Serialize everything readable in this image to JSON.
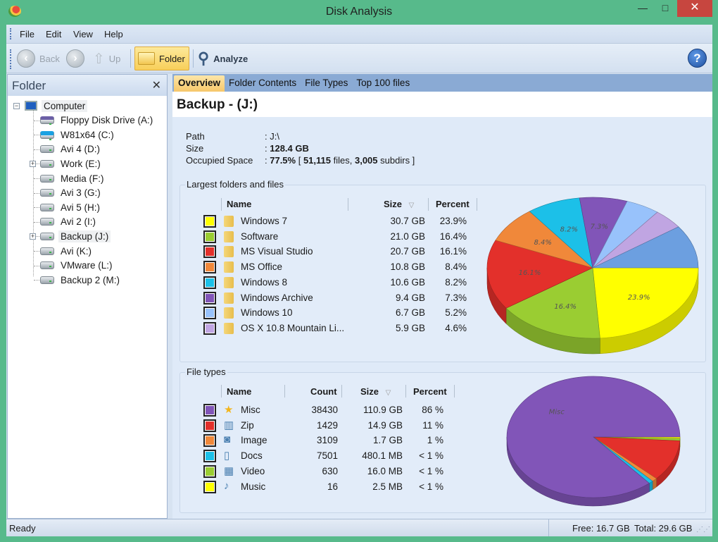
{
  "window": {
    "title": "Disk Analysis",
    "minimize": "—",
    "maximize": "□",
    "close": "✕"
  },
  "menu": [
    "File",
    "Edit",
    "View",
    "Help"
  ],
  "toolbar": {
    "back": "Back",
    "forward_icon": "arrow-right-icon",
    "up": "Up",
    "folder": "Folder",
    "analyze": "Analyze",
    "help": "?"
  },
  "sidebar": {
    "title": "Folder",
    "close": "✕",
    "root": "Computer",
    "items": [
      {
        "label": "Floppy Disk Drive (A:)",
        "icon": "floppy-icon",
        "expandable": false
      },
      {
        "label": "W81x64 (C:)",
        "icon": "windows-drive-icon",
        "expandable": false
      },
      {
        "label": "Avi 4 (D:)",
        "icon": "drive-icon",
        "expandable": false
      },
      {
        "label": "Work (E:)",
        "icon": "drive-icon",
        "expandable": true
      },
      {
        "label": "Media (F:)",
        "icon": "drive-icon",
        "expandable": false
      },
      {
        "label": "Avi 3 (G:)",
        "icon": "drive-icon",
        "expandable": false
      },
      {
        "label": "Avi 5 (H:)",
        "icon": "drive-icon",
        "expandable": false
      },
      {
        "label": "Avi 2 (I:)",
        "icon": "drive-icon",
        "expandable": false
      },
      {
        "label": "Backup (J:)",
        "icon": "drive-icon",
        "expandable": true,
        "selected": true
      },
      {
        "label": "Avi (K:)",
        "icon": "drive-icon",
        "expandable": false
      },
      {
        "label": "VMware (L:)",
        "icon": "drive-icon",
        "expandable": false
      },
      {
        "label": "Backup 2 (M:)",
        "icon": "drive-icon",
        "expandable": false
      }
    ]
  },
  "tabs": [
    {
      "label": "Overview",
      "active": true
    },
    {
      "label": "Folder Contents"
    },
    {
      "label": "File Types"
    },
    {
      "label": "Top 100 files"
    }
  ],
  "overview": {
    "heading": "Backup - (J:)",
    "path_label": "Path",
    "path_value": ": J:\\",
    "size_label": "Size",
    "size_value": "128.4 GB",
    "occupied_label": "Occupied Space",
    "occupied_pct": "77.5%",
    "files": "51,115",
    "files_word": "files,",
    "subdirs": "3,005",
    "subdirs_word": "subdirs ]"
  },
  "largest": {
    "title": "Largest folders and files",
    "columns": {
      "name": "Name",
      "size": "Size",
      "percent": "Percent"
    },
    "rows": [
      {
        "name": "Windows 7",
        "size": "30.7 GB",
        "percent": "23.9%",
        "color": "#ffff00"
      },
      {
        "name": "Software",
        "size": "21.0 GB",
        "percent": "16.4%",
        "color": "#9acd32"
      },
      {
        "name": "MS Visual Studio",
        "size": "20.7 GB",
        "percent": "16.1%",
        "color": "#e3302b"
      },
      {
        "name": "MS Office",
        "size": "10.8 GB",
        "percent": "8.4%",
        "color": "#f0883a"
      },
      {
        "name": "Windows 8",
        "size": "10.6 GB",
        "percent": "8.2%",
        "color": "#1cc0e8"
      },
      {
        "name": "Windows Archive",
        "size": "9.4 GB",
        "percent": "7.3%",
        "color": "#8155b8"
      },
      {
        "name": "Windows 10",
        "size": "6.7 GB",
        "percent": "5.2%",
        "color": "#98c2fb"
      },
      {
        "name": "OS X 10.8 Mountain Li...",
        "size": "5.9 GB",
        "percent": "4.6%",
        "color": "#c0a5e2"
      }
    ]
  },
  "filetypes": {
    "title": "File types",
    "columns": {
      "name": "Name",
      "count": "Count",
      "size": "Size",
      "percent": "Percent"
    },
    "rows": [
      {
        "name": "Misc",
        "count": "38430",
        "size": "110.9 GB",
        "percent": "86 %",
        "color": "#8155b8",
        "icon": "star-icon"
      },
      {
        "name": "Zip",
        "count": "1429",
        "size": "14.9 GB",
        "percent": "11 %",
        "color": "#e3302b",
        "icon": "zip-icon"
      },
      {
        "name": "Image",
        "count": "3109",
        "size": "1.7 GB",
        "percent": "1 %",
        "color": "#f0883a",
        "icon": "camera-icon"
      },
      {
        "name": "Docs",
        "count": "7501",
        "size": "480.1 MB",
        "percent": "< 1 %",
        "color": "#1cc0e8",
        "icon": "book-icon"
      },
      {
        "name": "Video",
        "count": "630",
        "size": "16.0 MB",
        "percent": "< 1 %",
        "color": "#9acd32",
        "icon": "film-icon"
      },
      {
        "name": "Music",
        "count": "16",
        "size": "2.5 MB",
        "percent": "< 1 %",
        "color": "#ffff00",
        "icon": "music-icon"
      }
    ]
  },
  "chart_data": [
    {
      "type": "pie",
      "style": "3d",
      "start": "3 o'clock, clockwise",
      "slices": [
        {
          "name": "Windows 7",
          "value": 23.9,
          "label": "23.9%",
          "color": "#ffff00"
        },
        {
          "name": "Software",
          "value": 16.4,
          "label": "16.4%",
          "color": "#9acd32"
        },
        {
          "name": "MS Visual Studio",
          "value": 16.1,
          "label": "16.1%",
          "color": "#e3302b"
        },
        {
          "name": "MS Office",
          "value": 8.4,
          "label": "8.4%",
          "color": "#f0883a"
        },
        {
          "name": "Windows 8",
          "value": 8.2,
          "label": "8.2%",
          "color": "#1cc0e8"
        },
        {
          "name": "Windows Archive",
          "value": 7.3,
          "label": "7.3%",
          "color": "#8155b8"
        },
        {
          "name": "Windows 10",
          "value": 5.2,
          "label": "",
          "color": "#98c2fb"
        },
        {
          "name": "OS X 10.8 Mountain Li...",
          "value": 4.6,
          "label": "",
          "color": "#c0a5e2"
        },
        {
          "name": "",
          "value": 9.9,
          "label": "",
          "color": "#6c9fe0"
        }
      ]
    },
    {
      "type": "pie",
      "style": "3d",
      "start": "3 o'clock, clockwise",
      "slices": [
        {
          "name": "Music",
          "value": 0.4,
          "label": "",
          "color": "#ffff00"
        },
        {
          "name": "Video",
          "value": 0.6,
          "label": "",
          "color": "#9acd32"
        },
        {
          "name": "Zip",
          "value": 11,
          "label": "",
          "color": "#e3302b"
        },
        {
          "name": "Image",
          "value": 1,
          "label": "",
          "color": "#f0883a"
        },
        {
          "name": "Docs",
          "value": 0.8,
          "label": "",
          "color": "#1cc0e8"
        },
        {
          "name": "Misc",
          "value": 86,
          "label": "Misc",
          "color": "#8155b8"
        }
      ]
    }
  ],
  "status": {
    "text": "Ready",
    "free": "Free: 16.7 GB",
    "total": "Total: 29.6 GB"
  }
}
